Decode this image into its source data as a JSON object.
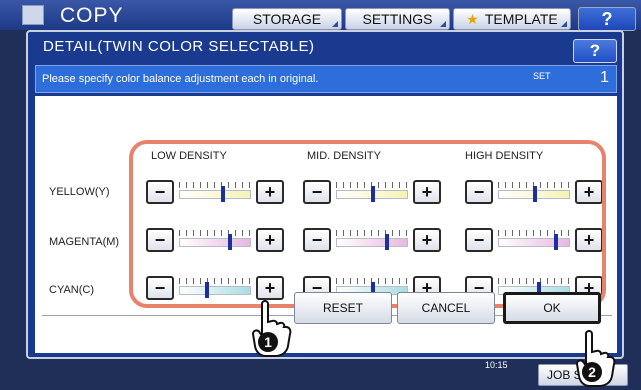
{
  "app": {
    "title": "COPY",
    "top_buttons": [
      "STORAGE",
      "SETTINGS",
      "TEMPLATE"
    ],
    "help_label": "?",
    "job_status_label": "JOB S",
    "clock": "10:15"
  },
  "dialog": {
    "title": "DETAIL(TWIN COLOR SELECTABLE)",
    "help_label": "?",
    "instruction": "Please specify color balance adjustment each in original.",
    "set_label": "SET",
    "set_value": "1",
    "columns": [
      "LOW DENSITY",
      "MID. DENSITY",
      "HIGH DENSITY"
    ],
    "rows": [
      {
        "label": "YELLOW(Y)",
        "color": "#f4f3b6",
        "levels": [
          0.62,
          0.52,
          0.52
        ]
      },
      {
        "label": "MAGENTA(M)",
        "color": "#e8b7e1",
        "levels": [
          0.72,
          0.72,
          0.82
        ]
      },
      {
        "label": "CYAN(C)",
        "color": "#a9dde4",
        "levels": [
          0.38,
          0.52,
          0.58
        ]
      }
    ],
    "minus_label": "−",
    "plus_label": "+",
    "buttons": {
      "reset": "RESET",
      "cancel": "CANCEL",
      "ok": "OK"
    }
  },
  "callouts": [
    "1",
    "2"
  ],
  "colors": {
    "highlight": "#e9826a",
    "knob": "#1b2fa0",
    "header": "#1a3a8f",
    "instruction_bar": "#2d6edb"
  }
}
